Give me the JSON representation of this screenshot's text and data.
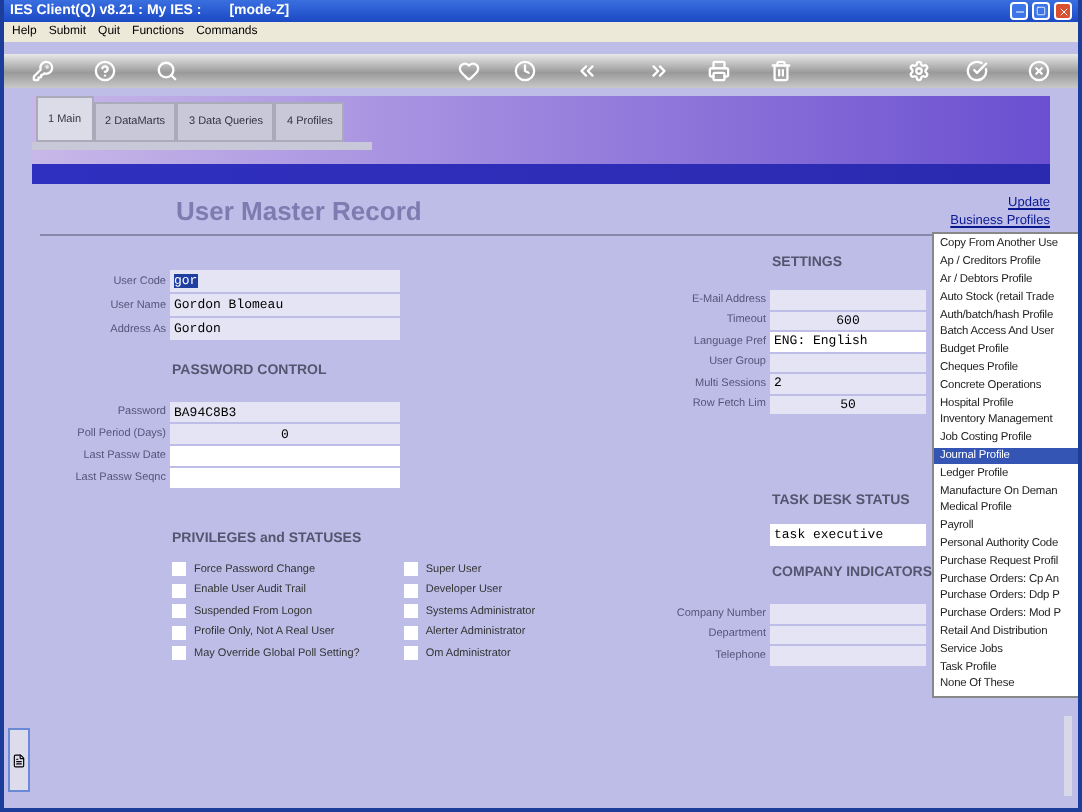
{
  "window": {
    "title": "IES Client(Q) v8.21 : My IES :",
    "mode": "[mode-Z]"
  },
  "menu_bar": [
    "Help",
    "Submit",
    "Quit",
    "Functions",
    "Commands"
  ],
  "tabs": [
    {
      "label": "1 Main",
      "selected": true
    },
    {
      "label": "2 DataMarts",
      "selected": false
    },
    {
      "label": "3 Data Queries",
      "selected": false
    },
    {
      "label": "4 Profiles",
      "selected": false
    }
  ],
  "form_title": "User Master Record",
  "links": [
    "Update",
    "Business Profiles"
  ],
  "user_fields": [
    {
      "label": "User Code",
      "value": "gor",
      "highlighted": true
    },
    {
      "label": "User Name",
      "value": "Gordon Blomeau",
      "highlighted": false
    },
    {
      "label": "Address As",
      "value": "Gordon",
      "highlighted": false
    }
  ],
  "password_control": {
    "title": "PASSWORD CONTROL",
    "fields": [
      {
        "label": "Password",
        "value": "BA94C8B3"
      },
      {
        "label": "Poll Period (Days)",
        "value": "0"
      },
      {
        "label": "Last Passw Date"
      },
      {
        "label": "Last Passw Seqnc"
      }
    ]
  },
  "privileges": {
    "title": "PRIVILEGES and STATUSES",
    "columns": [
      [
        {
          "label": "Force Password Change",
          "checked": false
        },
        {
          "label": "Enable User Audit Trail",
          "checked": false
        },
        {
          "label": "Suspended From Logon",
          "checked": false
        },
        {
          "label": "Profile Only, Not A Real User",
          "checked": false
        },
        {
          "label": "May Override Global Poll Setting?",
          "checked": false
        }
      ],
      [
        {
          "label": "Super User",
          "checked": false
        },
        {
          "label": "Developer User",
          "checked": false
        },
        {
          "label": "Systems Administrator",
          "checked": false
        },
        {
          "label": "Alerter Administrator",
          "checked": false
        },
        {
          "label": "Om Administrator",
          "checked": false
        }
      ]
    ]
  },
  "settings": {
    "title": "SETTINGS",
    "fields": [
      {
        "label": "E-Mail Address",
        "white": false
      },
      {
        "label": "Timeout",
        "value": "600",
        "white": false
      },
      {
        "label": "Language Pref",
        "value": "ENG: English",
        "white": true
      },
      {
        "label": "User Group",
        "white": false
      },
      {
        "label": "Multi Sessions",
        "value": "2",
        "white": false
      },
      {
        "label": "Row Fetch Lim",
        "value": "50",
        "white": false
      }
    ]
  },
  "task_desk_status": {
    "title": "TASK DESK STATUS",
    "value": "task executive"
  },
  "company_indicators": {
    "title": "COMPANY INDICATORS",
    "fields": [
      {
        "label": "Company Number"
      },
      {
        "label": "Department"
      },
      {
        "label": "Telephone"
      }
    ]
  },
  "profiles_menu": [
    {
      "label": "Copy From Another Use",
      "selected": false
    },
    {
      "label": "Ap / Creditors Profile",
      "selected": false
    },
    {
      "label": "Ar / Debtors Profile",
      "selected": false
    },
    {
      "label": "Auto Stock (retail Trade",
      "selected": false
    },
    {
      "label": "Auth/batch/hash Profile",
      "selected": false
    },
    {
      "label": "Batch Access And User",
      "selected": false
    },
    {
      "label": "Budget Profile",
      "selected": false
    },
    {
      "label": "Cheques Profile",
      "selected": false
    },
    {
      "label": "Concrete Operations",
      "selected": false
    },
    {
      "label": "Hospital Profile",
      "selected": false
    },
    {
      "label": "Inventory Management",
      "selected": false
    },
    {
      "label": "Job Costing Profile",
      "selected": false
    },
    {
      "label": "Journal Profile",
      "selected": true
    },
    {
      "label": "Ledger Profile",
      "selected": false
    },
    {
      "label": "Manufacture On Deman",
      "selected": false
    },
    {
      "label": "Medical Profile",
      "selected": false
    },
    {
      "label": "Payroll",
      "selected": false
    },
    {
      "label": "Personal Authority Code",
      "selected": false
    },
    {
      "label": "Purchase Request Profil",
      "selected": false
    },
    {
      "label": "Purchase Orders: Cp An",
      "selected": false
    },
    {
      "label": "Purchase Orders: Ddp P",
      "selected": false
    },
    {
      "label": "Purchase Orders: Mod P",
      "selected": false
    },
    {
      "label": "Retail And Distribution",
      "selected": false
    },
    {
      "label": "Service Jobs",
      "selected": false
    },
    {
      "label": "Task Profile",
      "selected": false
    },
    {
      "label": "None Of These",
      "selected": false
    }
  ]
}
